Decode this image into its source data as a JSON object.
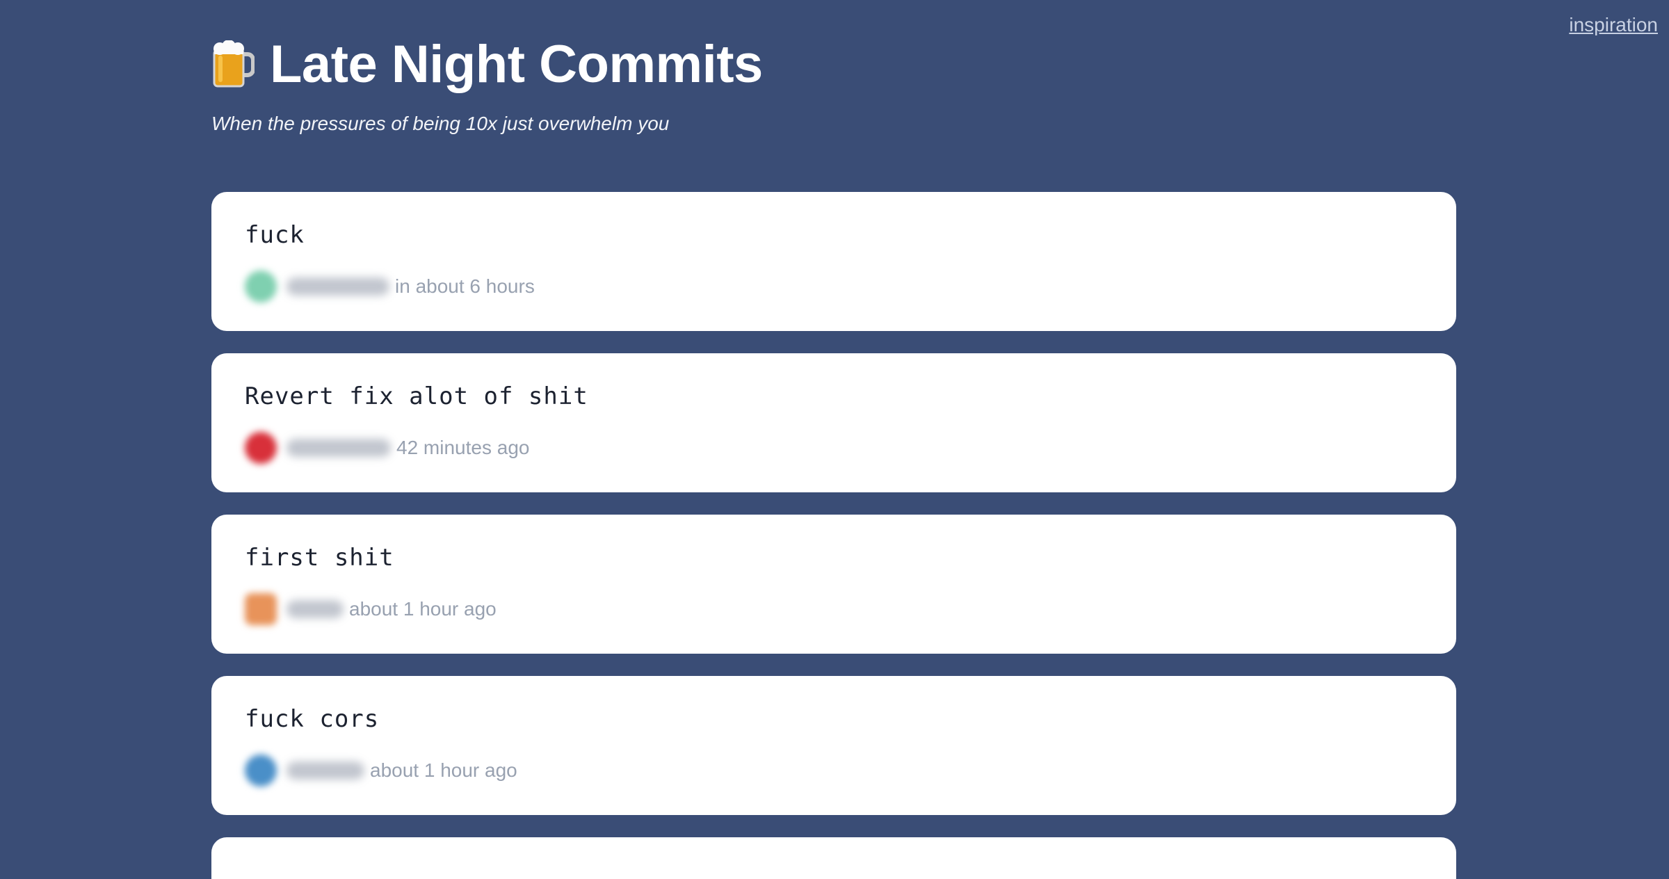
{
  "header": {
    "title": "Late Night Commits",
    "subtitle": "When the pressures of being 10x just overwhelm you",
    "icon": "beer-mug-icon",
    "inspiration_link": "inspiration"
  },
  "colors": {
    "background": "#3a4d76",
    "card": "#ffffff",
    "commit_text": "#1c2230",
    "meta_text": "#98a1b0"
  },
  "commits": [
    {
      "message": "fuck",
      "time": "in about 6 hours",
      "avatar_color": "#7fd0b0"
    },
    {
      "message": "Revert fix alot of shit",
      "time": "42 minutes ago",
      "avatar_color": "#d8303a"
    },
    {
      "message": "first shit",
      "time": "about 1 hour ago",
      "avatar_color": "#e8935a"
    },
    {
      "message": "fuck cors",
      "time": "about 1 hour ago",
      "avatar_color": "#4a8fc8"
    }
  ]
}
